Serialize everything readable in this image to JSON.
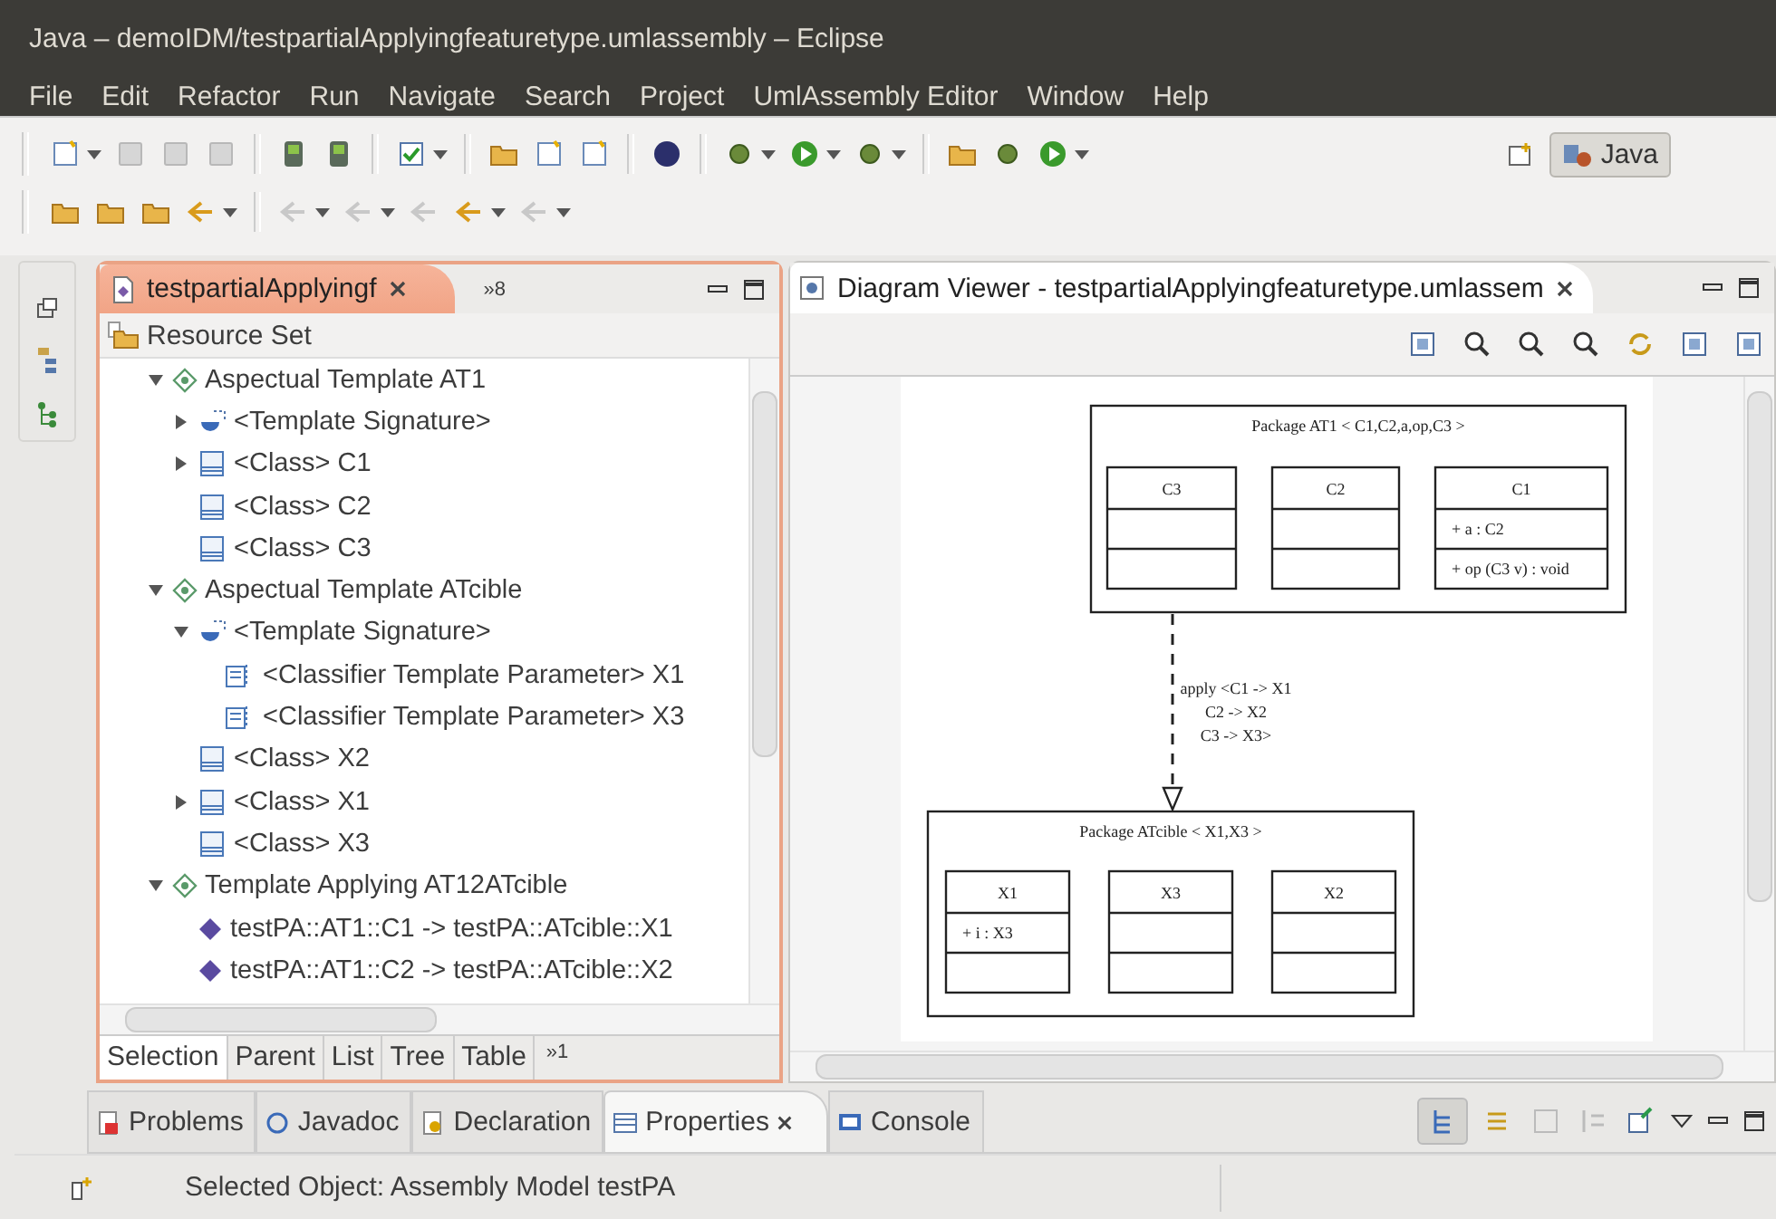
{
  "window": {
    "title": "Java – demoIDM/testpartialApplyingfeaturetype.umlassembly – Eclipse"
  },
  "menu": [
    "File",
    "Edit",
    "Refactor",
    "Run",
    "Navigate",
    "Search",
    "Project",
    "UmlAssembly Editor",
    "Window",
    "Help"
  ],
  "perspective": {
    "label": "Java",
    "selected": true
  },
  "editor_panel": {
    "tab": {
      "label": "testpartialApplyingf",
      "overflow": "»8"
    },
    "root": "Resource Set",
    "tree": [
      {
        "label": "Aspectual Template AT1",
        "kind": "template",
        "expanded": true,
        "children": [
          {
            "label": "<Template Signature>",
            "kind": "signature",
            "expanded": false
          },
          {
            "label": "<Class> C1",
            "kind": "class",
            "expanded": false
          },
          {
            "label": "<Class> C2",
            "kind": "class"
          },
          {
            "label": "<Class> C3",
            "kind": "class"
          }
        ]
      },
      {
        "label": "Aspectual Template ATcible",
        "kind": "template",
        "expanded": true,
        "children": [
          {
            "label": "<Template Signature>",
            "kind": "signature",
            "expanded": true,
            "children": [
              {
                "label": "<Classifier Template Parameter> X1",
                "kind": "parameter"
              },
              {
                "label": "<Classifier Template Parameter> X3",
                "kind": "parameter"
              }
            ]
          },
          {
            "label": "<Class> X2",
            "kind": "class"
          },
          {
            "label": "<Class> X1",
            "kind": "class",
            "expanded": false
          },
          {
            "label": "<Class> X3",
            "kind": "class"
          }
        ]
      },
      {
        "label": "Template Applying AT12ATcible",
        "kind": "template",
        "expanded": true,
        "children": [
          {
            "label": "testPA::AT1::C1 -> testPA::ATcible::X1",
            "kind": "binding"
          },
          {
            "label": "testPA::AT1::C2 -> testPA::ATcible::X2",
            "kind": "binding"
          }
        ]
      }
    ],
    "bottom_tabs": [
      {
        "label": "Selection",
        "selected": true
      },
      {
        "label": "Parent",
        "selected": false
      },
      {
        "label": "List",
        "selected": false
      },
      {
        "label": "Tree",
        "selected": false
      },
      {
        "label": "Table",
        "selected": false
      }
    ],
    "bottom_overflow": "»1"
  },
  "diagram_panel": {
    "tab": {
      "label": "Diagram Viewer - testpartialApplyingfeaturetype.umlassem"
    },
    "packages": [
      {
        "title": "Package AT1  < C1,C2,a,op,C3 >",
        "classes": [
          {
            "name": "C3"
          },
          {
            "name": "C2"
          },
          {
            "name": "C1",
            "attributes": [
              "+ a : C2"
            ],
            "operations": [
              "+ op (C3 v) :  void"
            ]
          }
        ]
      },
      {
        "title": "Package ATcible  < X1,X3 >",
        "classes": [
          {
            "name": "X1",
            "attributes": [
              "+ i : X3"
            ]
          },
          {
            "name": "X3"
          },
          {
            "name": "X2"
          }
        ]
      }
    ],
    "dependency_label": [
      "apply <C1 -> X1",
      "C2 -> X2",
      "C3 -> X3>"
    ]
  },
  "bottom_tabs": [
    {
      "label": "Problems",
      "selected": false
    },
    {
      "label": "Javadoc",
      "selected": false
    },
    {
      "label": "Declaration",
      "selected": false
    },
    {
      "label": "Properties",
      "selected": true
    },
    {
      "label": "Console",
      "selected": false
    }
  ],
  "status_bar": {
    "text": "Selected Object: Assembly Model testPA"
  }
}
